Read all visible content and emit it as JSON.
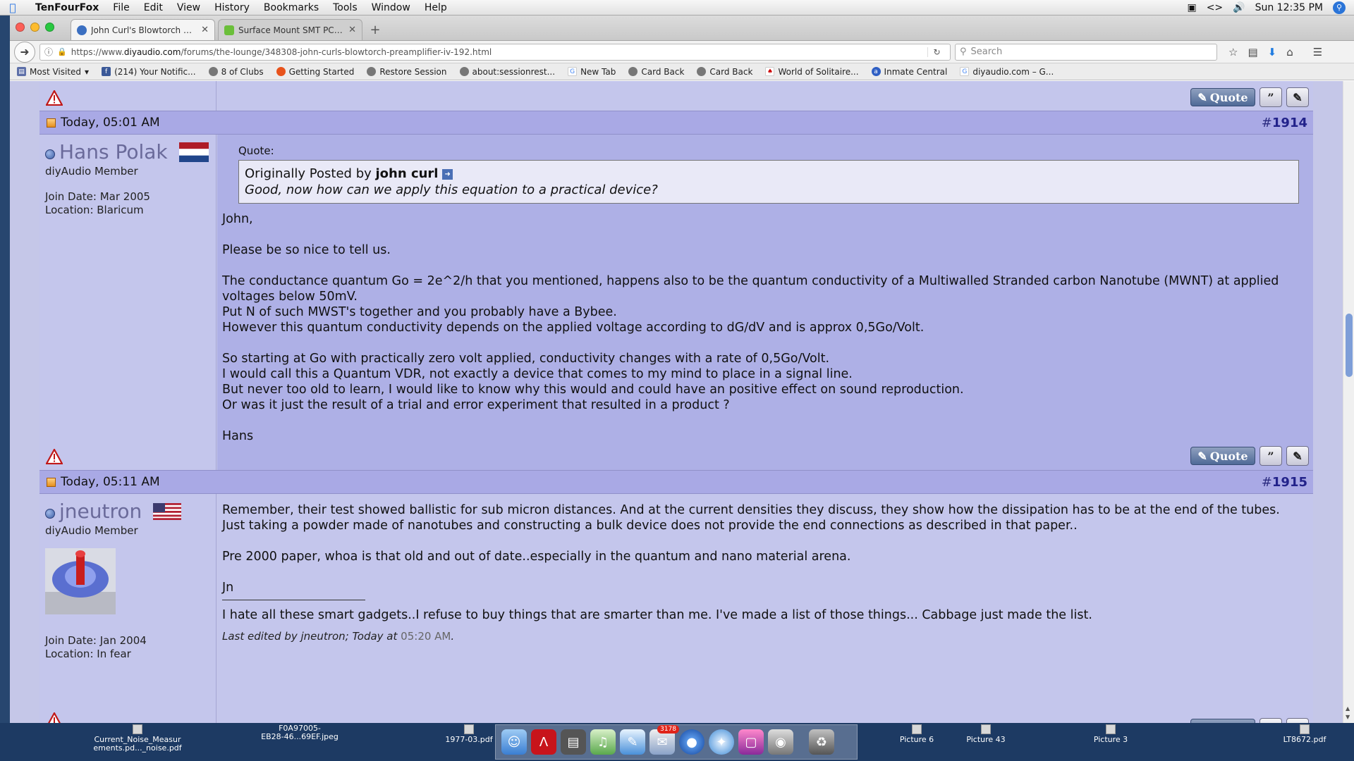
{
  "menubar": {
    "app_name": "TenFourFox",
    "items": [
      "File",
      "Edit",
      "View",
      "History",
      "Bookmarks",
      "Tools",
      "Window",
      "Help"
    ],
    "clock": "Sun 12:35 PM"
  },
  "browser": {
    "tabs": [
      {
        "title": "John Curl's Blowtorch prea..."
      },
      {
        "title": "Surface Mount SMT PCB A..."
      }
    ],
    "url_prefix": "https://www.",
    "url_domain": "diyaudio.com",
    "url_path": "/forums/the-lounge/348308-john-curls-blowtorch-preamplifier-iv-192.html",
    "search_placeholder": "Search",
    "bookmarks": [
      "Most Visited",
      "(214) Your Notific...",
      "8 of Clubs",
      "Getting Started",
      "Restore Session",
      "about:sessionrest...",
      "New Tab",
      "Card Back",
      "Card Back",
      "World of Solitaire...",
      "Inmate Central",
      "diyaudio.com – G..."
    ]
  },
  "buttons": {
    "quote_label": "Quote"
  },
  "posts": [
    {
      "date": "Today, 05:01 AM",
      "number_prefix": "#",
      "number": "1914",
      "user": "Hans Polak",
      "title": "diyAudio Member",
      "join_date": "Join Date: Mar 2005",
      "location": "Location: Blaricum",
      "quote_label": "Quote:",
      "quote_intro": "Originally Posted by",
      "quote_author": "john curl",
      "quote_text": "Good, now how can we apply this equation to a practical device?",
      "paragraphs": [
        [
          "John,"
        ],
        [
          "Please be so nice to tell us."
        ],
        [
          "The conductance quantum Go = 2e^2/h that you mentioned, happens also to be the quantum conductivity of a Multiwalled Stranded carbon Nanotube (MWNT) at applied voltages below 50mV.",
          "Put N of such MWST's together and you probably have a Bybee.",
          "However this quantum conductivity depends on the applied voltage according to dG/dV and is approx 0,5Go/Volt."
        ],
        [
          "So starting at Go with practically zero volt applied, conductivity changes with a rate of 0,5Go/Volt.",
          "I would call this a Quantum VDR, not exactly a device that comes to my mind to place in a signal line.",
          "But never too old to learn, I would like to know why this would and could have an positive effect on sound reproduction.",
          "Or was it just the result of a trial and error experiment that resulted in a product ?"
        ],
        [
          "Hans"
        ]
      ]
    },
    {
      "date": "Today, 05:11 AM",
      "number_prefix": "#",
      "number": "1915",
      "user": "jneutron",
      "title": "diyAudio Member",
      "join_date": "Join Date: Jan 2004",
      "location": "Location: In fear",
      "paragraphs": [
        [
          "Remember, their test showed ballistic for sub micron distances. And at the current densities they discuss, they show how the dissipation has to be at the end of the tubes.",
          "Just taking a powder made of nanotubes and constructing a bulk device does not provide the end connections as described in that paper.."
        ],
        [
          "Pre 2000 paper, whoa is that old and out of date..especially in the quantum and nano material arena."
        ],
        [
          "Jn"
        ]
      ],
      "signature": "I hate all these smart gadgets..I refuse to buy things that are smarter than me. I've made a list of those things... Cabbage just made the list.",
      "edited_prefix": "Last edited by jneutron; Today at",
      "edited_time": "05:20 AM",
      "edited_suffix": "."
    }
  ],
  "dock": {
    "files": [
      {
        "line1": "Current_Noise_Measur",
        "line2": "ements.pd..._noise.pdf"
      },
      {
        "line1": "F0A97005-",
        "line2": "EB28-46...69EF.jpeg"
      },
      {
        "line1": "1977-03.pdf",
        "line2": ""
      },
      {
        "line1": "Picture 6",
        "line2": ""
      },
      {
        "line1": "Picture 43",
        "line2": ""
      },
      {
        "line1": "Picture 3",
        "line2": ""
      },
      {
        "line1": "LT8672.pdf",
        "line2": ""
      }
    ],
    "mail_badge": "3178"
  },
  "colors": {
    "page_bg": "#c5c7e8",
    "post_header": "#a9a9e5",
    "post_number": "#22228a",
    "dock_bg": "#1d3a63"
  }
}
